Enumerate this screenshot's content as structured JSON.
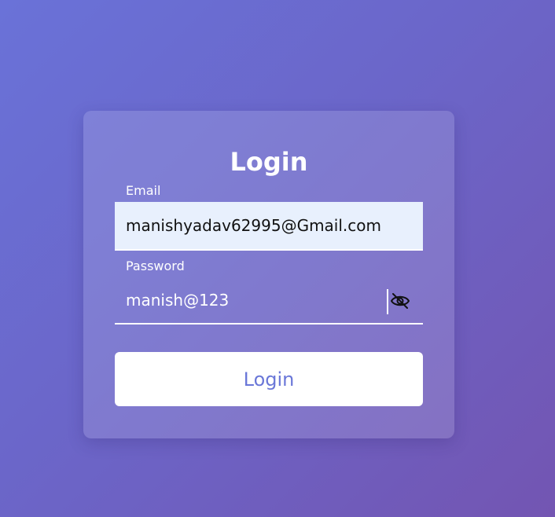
{
  "login_form": {
    "title": "Login",
    "email_label": "Email",
    "email_value": "manishyadav62995@Gmail.com",
    "password_label": "Password",
    "password_value": "manish@123",
    "password_toggle_icon": "eye-off-icon",
    "submit_label": "Login"
  },
  "colors": {
    "background_start": "#6a72d8",
    "background_end": "#7355b2",
    "email_field_bg": "#e8f0fd",
    "button_bg": "#ffffff",
    "button_text": "#6a77d8"
  }
}
